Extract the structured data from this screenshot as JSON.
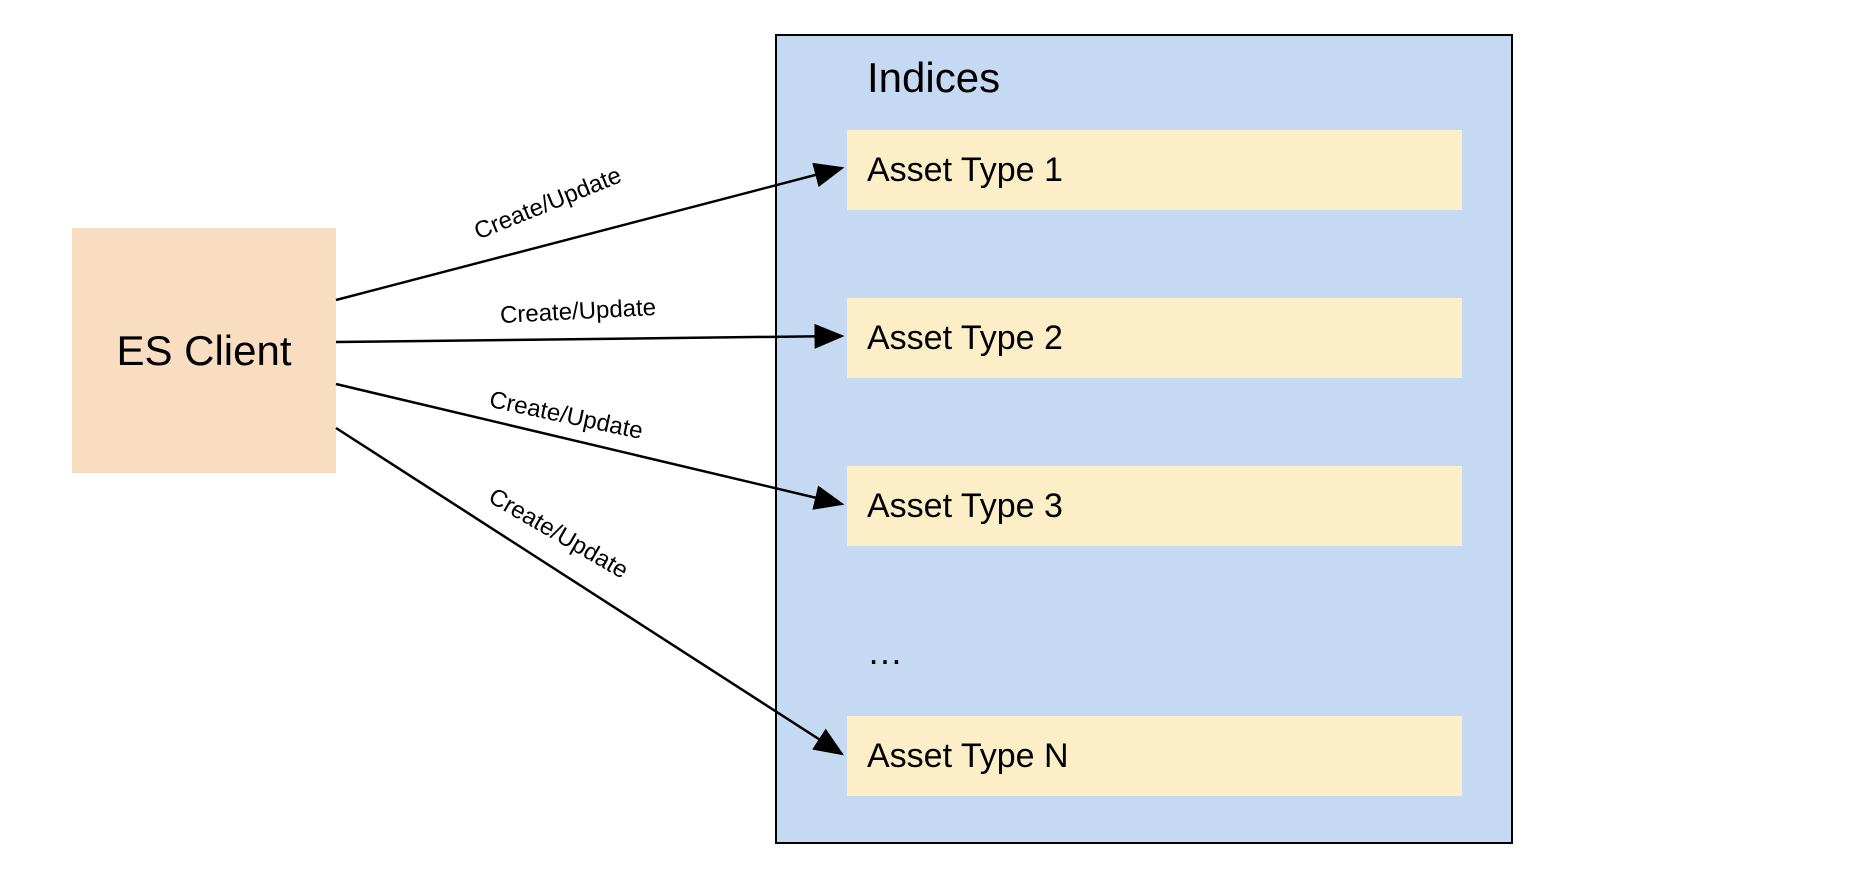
{
  "client": {
    "label": "ES Client"
  },
  "indices_container": {
    "title": "Indices",
    "items": {
      "item1": "Asset Type 1",
      "item2": "Asset Type 2",
      "item3": "Asset Type 3",
      "itemN": "Asset Type N",
      "ellipsis": "…"
    }
  },
  "edges": {
    "label1": "Create/Update",
    "label2": "Create/Update",
    "label3": "Create/Update",
    "label4": "Create/Update"
  }
}
